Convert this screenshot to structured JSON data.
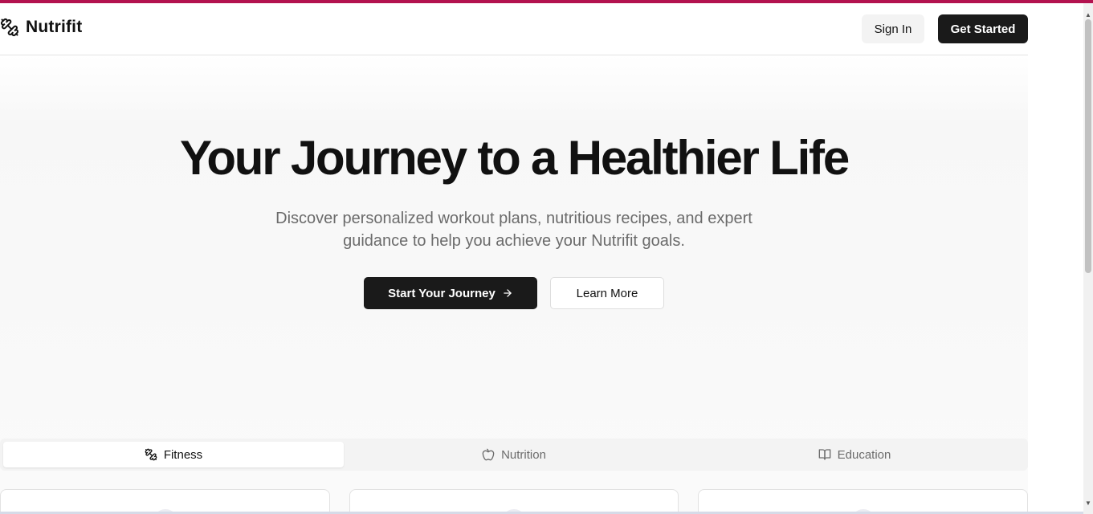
{
  "colors": {
    "accent_bar": "#b3124f",
    "primary_button": "#1a1a1a",
    "muted_text": "#6b6b6b"
  },
  "header": {
    "brand": "Nutrifit",
    "brand_icon": "dumbbell-icon",
    "sign_in_label": "Sign In",
    "get_started_label": "Get Started"
  },
  "hero": {
    "title": "Your Journey to a Healthier Life",
    "subtitle_line1": "Discover personalized workout plans, nutritious recipes, and expert",
    "subtitle_line2": "guidance to help you achieve your Nutrifit goals.",
    "start_label": "Start Your Journey",
    "start_icon": "arrow-right-icon",
    "learn_more_label": "Learn More"
  },
  "tabs": [
    {
      "label": "Fitness",
      "icon": "dumbbell-icon",
      "active": true
    },
    {
      "label": "Nutrition",
      "icon": "apple-icon",
      "active": false
    },
    {
      "label": "Education",
      "icon": "book-open-icon",
      "active": false
    }
  ]
}
